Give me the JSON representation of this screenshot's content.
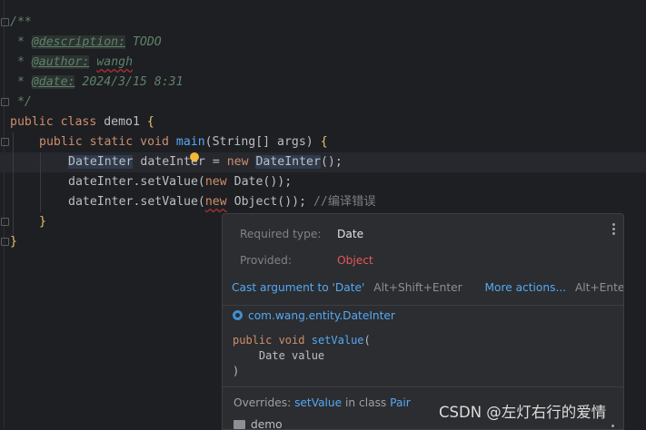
{
  "code": {
    "l1": "/**",
    "l2_star": " * ",
    "l2_tag": "@description:",
    "l2_text": " TODO",
    "l3_star": " * ",
    "l3_tag": "@author:",
    "l3_text": "wangh",
    "l4_star": " * ",
    "l4_tag": "@date:",
    "l4_text": " 2024/3/15 8:31",
    "l5": " */",
    "l6_kw": "public class",
    "l6_name": " demo1 ",
    "l6_brace": "{",
    "l7_kw": "public static void",
    "l7_fn": "main",
    "l7_rest": "(String[] args) ",
    "l7_brace": "{",
    "l8_type": "DateInter",
    "l8_var": " dateInter",
    "l8_eq": " = ",
    "l8_new": "new",
    "l8_ctor": "DateInter",
    "l8_end": "();",
    "l9_obj": "dateInter.setValue(",
    "l9_new": "new",
    "l9_arg": " Date());",
    "l10_obj": "dateInter.setValue(",
    "l10_new": "new",
    "l10_arg": " Object());",
    "l10_cmt": " //编译错误",
    "l11": "}",
    "l12": "}"
  },
  "popup": {
    "required_label": "Required type:",
    "required_value": "Date",
    "provided_label": "Provided:",
    "provided_value": "Object",
    "cast_action": "Cast argument to 'Date'",
    "cast_shortcut": "Alt+Shift+Enter",
    "more_action": "More actions...",
    "more_shortcut": "Alt+Enter",
    "class_path": "com.wang.entity.DateInter",
    "sig_kw": "public void",
    "sig_fn": "setValue",
    "sig_open": "(",
    "sig_param": "    Date value",
    "sig_close": ")",
    "overrides_prefix": "Overrides: ",
    "overrides_method": "setValue",
    "overrides_mid": " in class ",
    "overrides_class": "Pair",
    "package": "demo"
  },
  "watermark": "CSDN @左灯右行的爱情",
  "colors": {
    "background": "#1e1f22",
    "keyword": "#cf8e6d",
    "function": "#56a8f5",
    "doc_comment": "#5f826b",
    "error": "#e5575b",
    "popup_bg": "#2b2d30"
  }
}
